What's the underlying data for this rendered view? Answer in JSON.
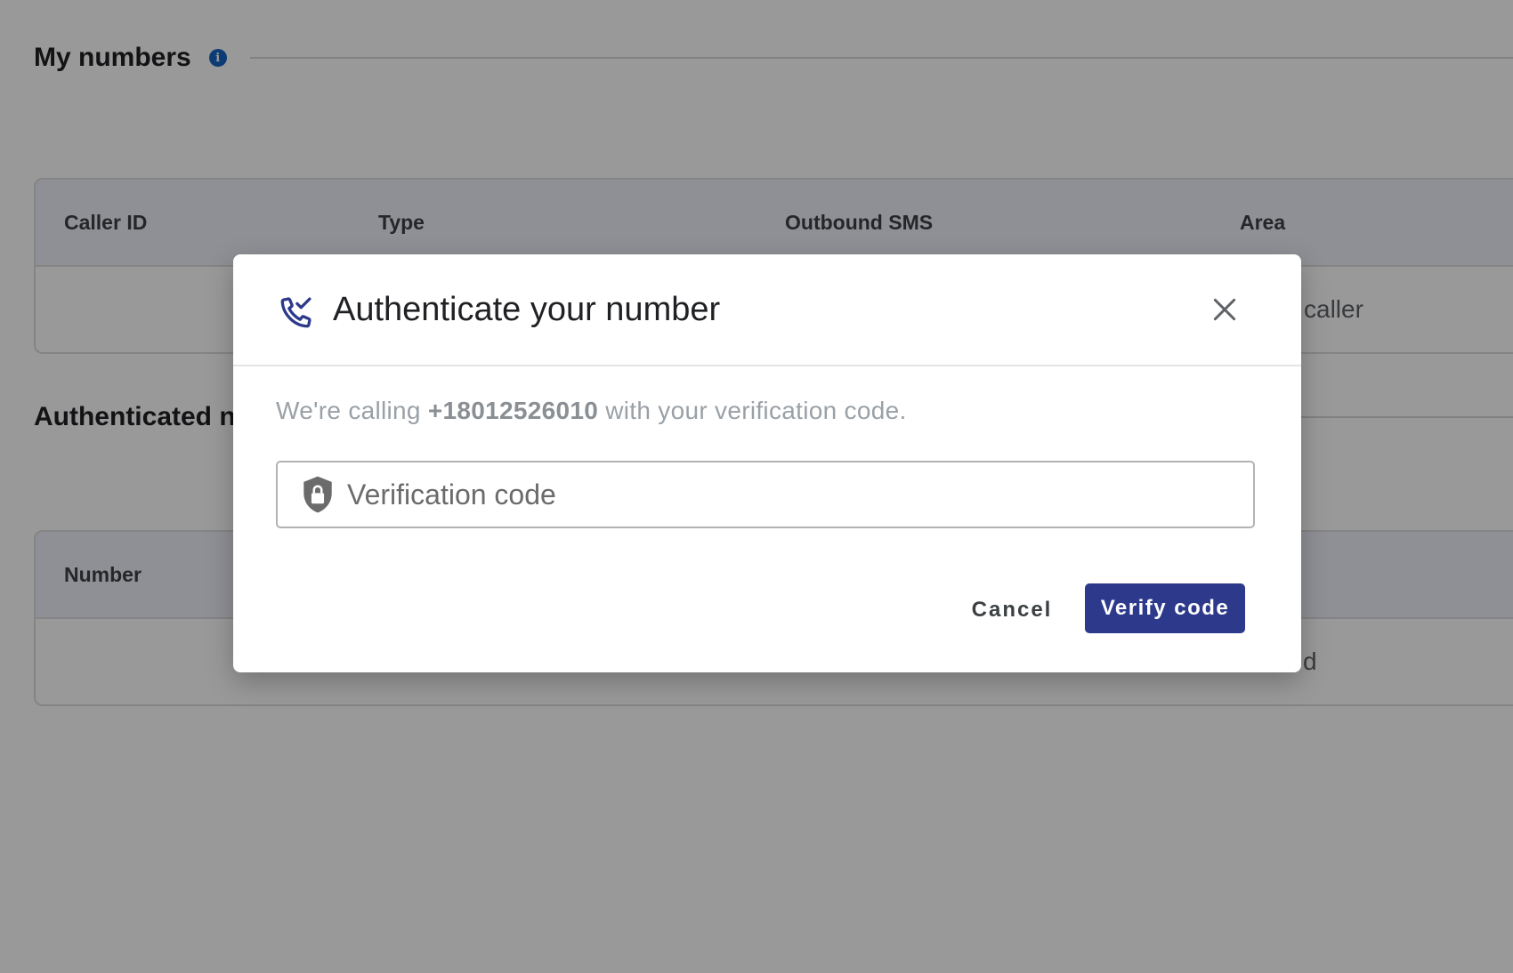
{
  "background": {
    "my_numbers": {
      "title": "My numbers",
      "table": {
        "columns": [
          "Caller ID",
          "Type",
          "Outbound SMS",
          "Area"
        ],
        "row_fragment": "caller"
      }
    },
    "authenticated": {
      "title": "Authenticated n",
      "table": {
        "columns": [
          "Number"
        ],
        "row_fragment": "d"
      }
    }
  },
  "dialog": {
    "title": "Authenticate your number",
    "description_prefix": "We're calling ",
    "phone_number": "+18012526010",
    "description_suffix": " with your verification code.",
    "input": {
      "placeholder": "Verification code",
      "value": ""
    },
    "buttons": {
      "cancel": "Cancel",
      "verify": "Verify code"
    }
  },
  "icons": {
    "dialog": "phone-check-icon",
    "close": "close-icon",
    "input": "shield-lock-icon",
    "info": "info-icon"
  },
  "colors": {
    "primary": "#2d3a8c",
    "icon_accent": "#2d3a8c",
    "info": "#1565c0"
  }
}
